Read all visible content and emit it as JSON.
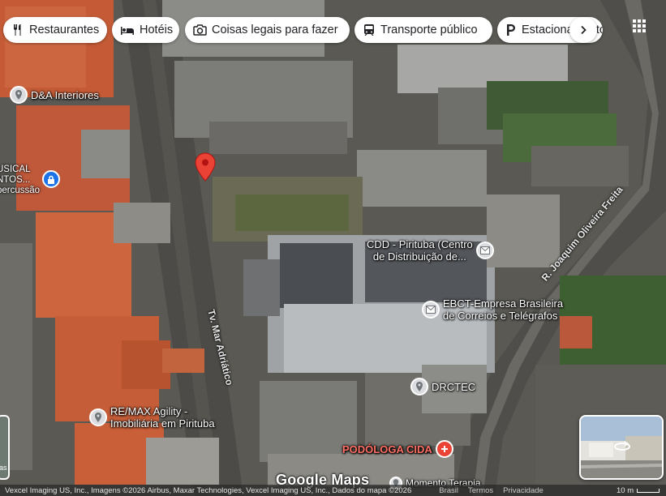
{
  "filter_chips": [
    {
      "label": "Restaurantes",
      "icon": "fork-knife-icon"
    },
    {
      "label": "Hotéis",
      "icon": "bed-icon"
    },
    {
      "label": "Coisas legais para fazer",
      "icon": "camera-icon"
    },
    {
      "label": "Transporte público",
      "icon": "train-icon"
    },
    {
      "label": "Estacionamento",
      "icon": "parking-icon"
    }
  ],
  "places": [
    {
      "name": "D&A Interiores",
      "icon": "pin-icon"
    },
    {
      "name": "CDD - Pirituba (Centro\nde Distribuição de...",
      "icon": "mail-icon"
    },
    {
      "name": "EBCT-Empresa Brasileira\nde Correios e Telégrafos",
      "icon": "mail-icon"
    },
    {
      "name": "DRCTEC",
      "icon": "pin-icon"
    },
    {
      "name": "RE/MAX Agility -\nImobiliária em Pirituba",
      "icon": "pin-icon"
    },
    {
      "name": "PODÓLOGA CIDA",
      "icon": "medical-icon"
    },
    {
      "name": "Momento Terapia",
      "icon": "pin-icon"
    }
  ],
  "partial_labels": {
    "music_store": "USICAL\nNTOS...\npercussão"
  },
  "streets": {
    "mar_adriatico": "Tv. Mar Adriático",
    "joaquim_oliveira": "R. Joaquim Oliveira Freita"
  },
  "left_thumbnail_text": "as",
  "watermark": "Google Maps",
  "footer": {
    "attribution": "Vexcel Imaging US, Inc., Imagens ©2026 Airbus, Maxar Technologies, Vexcel Imaging US, Inc., Dados do mapa ©2026",
    "links": [
      "Brasil",
      "Termos",
      "Privacidade"
    ],
    "scale": "10 m"
  },
  "colors": {
    "marker": "#ea4335",
    "clay_roof": "#c95f38",
    "podologa_label": "#ff6e64"
  }
}
